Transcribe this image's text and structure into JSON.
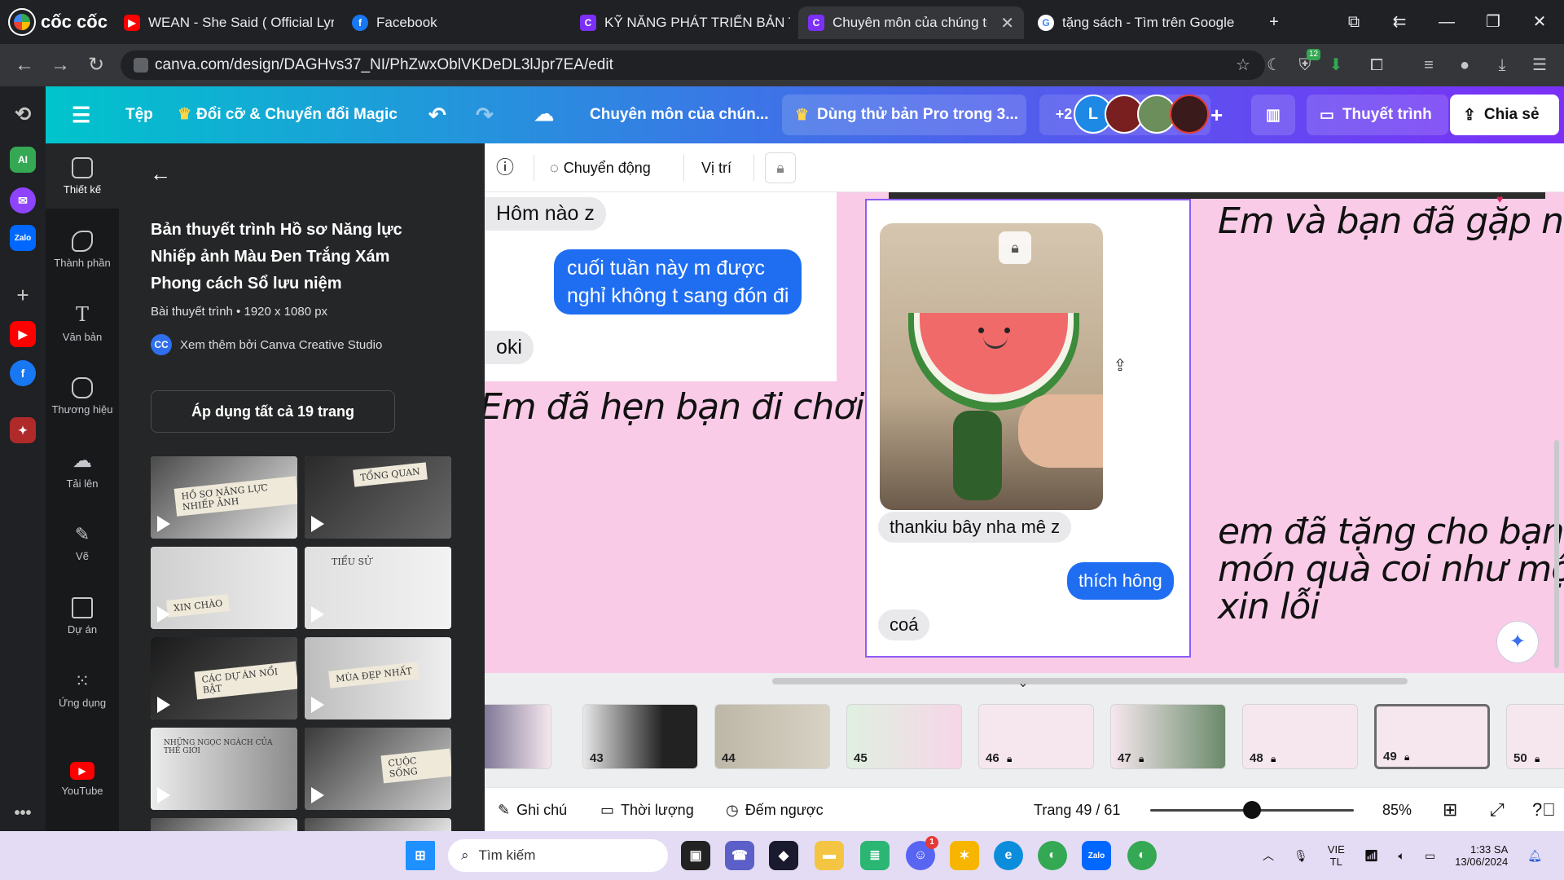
{
  "browser": {
    "brand": "cốc cốc",
    "tabs": [
      {
        "title": "WEAN - She Said ( Official Lyric",
        "icon": "youtube-icon",
        "color": "#ff0000"
      },
      {
        "title": "Facebook",
        "icon": "facebook-icon",
        "color": "#1877f2"
      },
      {
        "title": "KỸ NĂNG PHÁT TRIỂN BẢN THÂ",
        "icon": "canva-shield-icon",
        "color": "#7b2ff7"
      },
      {
        "title": "Chuyên môn của chúng tô",
        "icon": "canva-shield-icon",
        "color": "#7b2ff7"
      },
      {
        "title": "tặng sách - Tìm trên Google",
        "icon": "google-icon",
        "color": "#ffffff"
      }
    ],
    "url": "canva.com/design/DAGHvs37_NI/PhZwxOblVKDeDL3lJpr7EA/edit",
    "extension_badge": "12"
  },
  "canva_top": {
    "menu_file": "Tệp",
    "resize_label": "Đổi cỡ & Chuyển đổi Magic",
    "design_title": "Chuyên môn của chún...",
    "pro_trial": "Dùng thử bản Pro trong 3...",
    "collab_more": "+2",
    "collab_initial": "L",
    "present_label": "Thuyết trình",
    "share_label": "Chia sẻ"
  },
  "rail": [
    {
      "label": "Thiết kế",
      "icon": "design-icon"
    },
    {
      "label": "Thành phần",
      "icon": "elements-icon"
    },
    {
      "label": "Văn bản",
      "icon": "text-icon"
    },
    {
      "label": "Thương hiệu",
      "icon": "brand-icon"
    },
    {
      "label": "Tải lên",
      "icon": "upload-icon"
    },
    {
      "label": "Vẽ",
      "icon": "draw-icon"
    },
    {
      "label": "Dự án",
      "icon": "projects-icon"
    },
    {
      "label": "Ứng dụng",
      "icon": "apps-icon"
    },
    {
      "label": "YouTube",
      "icon": "youtube-icon"
    }
  ],
  "panel": {
    "title": "Bản thuyết trình Hồ sơ Năng lực Nhiếp ảnh Màu Đen Trắng Xám Phong cách Sổ lưu niệm",
    "subtitle": "Bài thuyết trình • 1920 x 1080 px",
    "creator_initials": "CC",
    "creator": "Xem thêm bởi Canva Creative Studio",
    "apply_button": "Áp dụng tất cả 19 trang",
    "thumbs": [
      "HỒ SƠ NĂNG LỰC NHIẾP ẢNH",
      "TỔNG QUAN",
      "XIN CHÀO",
      "TIỂU SỬ",
      "CÁC DỰ ÁN NỔI BẬT",
      "MÙA ĐẸP NHẤT",
      "NHỮNG NGỌC NGÀCH CỦA THẾ GIỚI",
      "CUỘC SỐNG"
    ]
  },
  "toolbar": {
    "animate": "Chuyển động",
    "position": "Vị trí"
  },
  "slide": {
    "chat_left_1": "Hôm nào z",
    "chat_right_1_line1": "cuối tuần này m được",
    "chat_right_1_line2": "nghỉ không t sang đón đi",
    "chat_left_2": "oki",
    "caption_1": "Em đã hẹn bạn đi chơi",
    "caption_2": "Em và bạn đã gặp nha",
    "caption_3_line1": "em đã tặng cho bạn m",
    "caption_3_line2": "món quà coi như một",
    "caption_3_line3": "xin lỗi",
    "card_left_1": "thankiu bây nha mê z",
    "card_right_1": "thích hông",
    "card_left_2": "coá"
  },
  "pages": [
    "",
    "43",
    "44",
    "45",
    "46",
    "47",
    "48",
    "49",
    "50"
  ],
  "bottom": {
    "notes": "Ghi chú",
    "duration": "Thời lượng",
    "timer": "Đếm ngược",
    "page_indicator": "Trang 49 / 61",
    "zoom": "85%",
    "zoom_level": 0.5
  },
  "taskbar": {
    "search_placeholder": "Tìm kiếm",
    "discord_badge": "1",
    "lang_1": "VIE",
    "lang_2": "TL",
    "time": "1:33 SA",
    "date": "13/06/2024"
  }
}
